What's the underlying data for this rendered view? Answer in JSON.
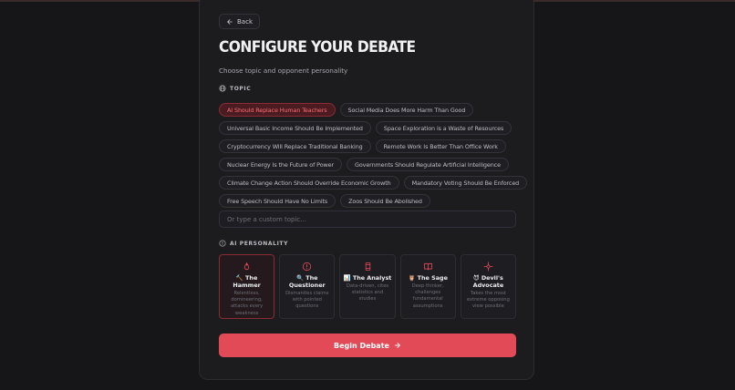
{
  "header": {
    "back_label": "Back",
    "title": "CONFIGURE YOUR DEBATE",
    "subtitle": "Choose topic and opponent personality"
  },
  "topic_section": {
    "label": "TOPIC",
    "rows": [
      [
        {
          "label": "AI Should Replace Human Teachers",
          "selected": true
        },
        {
          "label": "Social Media Does More Harm Than Good",
          "selected": false
        }
      ],
      [
        {
          "label": "Universal Basic Income Should Be Implemented",
          "selected": false
        },
        {
          "label": "Space Exploration is a Waste of Resources",
          "selected": false
        }
      ],
      [
        {
          "label": "Cryptocurrency Will Replace Traditional Banking",
          "selected": false
        },
        {
          "label": "Remote Work Is Better Than Office Work",
          "selected": false
        }
      ],
      [
        {
          "label": "Nuclear Energy Is the Future of Power",
          "selected": false
        },
        {
          "label": "Governments Should Regulate Artificial Intelligence",
          "selected": false
        }
      ],
      [
        {
          "label": "Climate Change Action Should Override Economic Growth",
          "selected": false
        },
        {
          "label": "Mandatory Voting Should Be Enforced",
          "selected": false
        }
      ],
      [
        {
          "label": "Free Speech Should Have No Limits",
          "selected": false
        },
        {
          "label": "Zoos Should Be Abolished",
          "selected": false
        }
      ]
    ],
    "custom_placeholder": "Or type a custom topic..."
  },
  "personality_section": {
    "label": "AI PERSONALITY",
    "cards": [
      {
        "icon": "flame-icon",
        "name": "🔨 The Hammer",
        "description": "Relentless, domineering, attacks every weakness",
        "selected": true
      },
      {
        "icon": "alert-circle-icon",
        "name": "🔍 The Questioner",
        "description": "Dismantles claims with pointed questions",
        "selected": false
      },
      {
        "icon": "analyst-icon",
        "name": "📊 The Analyst",
        "description": "Data-driven, cites statistics and studies",
        "selected": false
      },
      {
        "icon": "book-icon",
        "name": "🦉 The Sage",
        "description": "Deep thinker, challenges fundamental assumptions",
        "selected": false
      },
      {
        "icon": "sparkle-icon",
        "name": "😈 Devil's Advocate",
        "description": "Takes the most extreme opposing view possible",
        "selected": false
      }
    ]
  },
  "actions": {
    "begin_label": "Begin Debate"
  },
  "colors": {
    "accent": "#e34a57",
    "background": "#161618",
    "panel": "#1c1c1f"
  }
}
